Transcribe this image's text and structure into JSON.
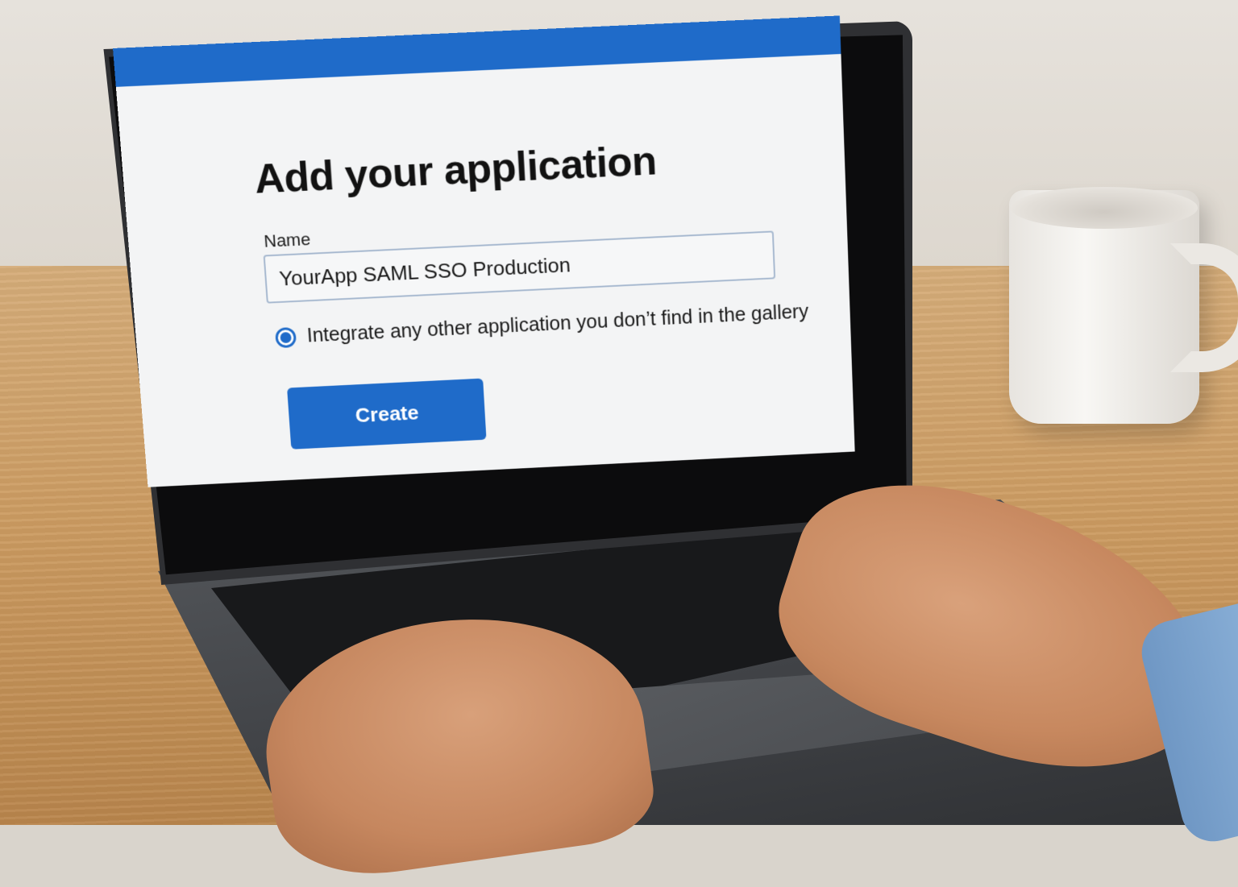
{
  "app": {
    "header_color": "#1f6bc9",
    "accent": "#1f6bc9"
  },
  "page": {
    "title": "Add your application"
  },
  "form": {
    "name_label": "Name",
    "name_value": "YourApp SAML SSO Production",
    "option_label": "Integrate any other application you don’t find in the gallery",
    "option_selected": true,
    "create_label": "Create"
  }
}
